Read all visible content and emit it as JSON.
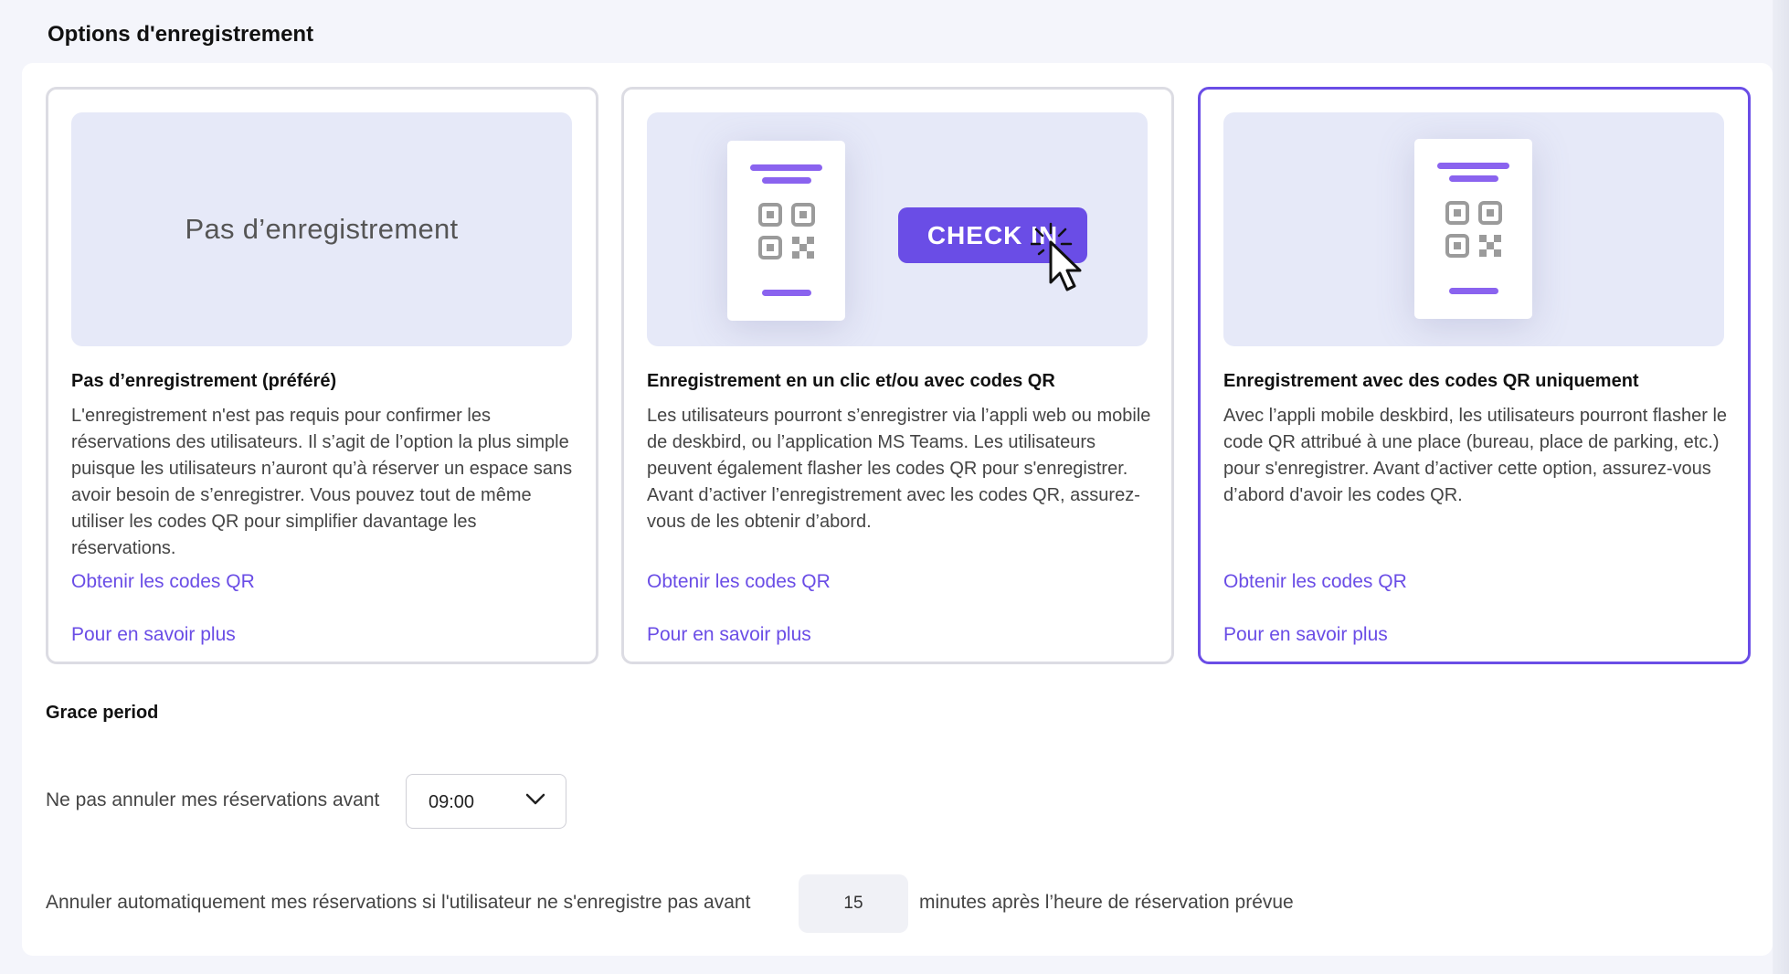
{
  "header": {
    "title": "Options d'enregistrement"
  },
  "cards": [
    {
      "illustration_text": "Pas d’enregistrement",
      "title": "Pas d’enregistrement (préféré)",
      "description": "L'enregistrement n'est pas requis pour confirmer les réservations des utilisateurs. Il s’agit de l’option la plus simple puisque les utilisateurs n’auront qu’à réserver un espace sans avoir besoin de s’enregistrer. Vous pouvez tout de même utiliser les codes QR pour simplifier davantage les réservations.",
      "link_qr": "Obtenir les codes QR",
      "link_more": "Pour en savoir plus",
      "selected": false
    },
    {
      "illustration_button": "CHECK IN",
      "title": "Enregistrement en un clic et/ou avec codes QR",
      "description": "Les utilisateurs pourront s’enregistrer via l’appli web ou mobile de deskbird, ou l’application MS Teams. Les utilisateurs peuvent également flasher les codes QR pour s'enregistrer. Avant d’activer l’enregistrement avec les codes QR, assurez-vous de les obtenir d’abord.",
      "link_qr": "Obtenir les codes QR",
      "link_more": "Pour en savoir plus",
      "selected": false
    },
    {
      "title": "Enregistrement avec des codes QR uniquement",
      "description": "Avec l’appli mobile deskbird, les utilisateurs pourront flasher le code QR attribué à une place (bureau, place de parking, etc.) pour s'enregistrer. Avant d’activer cette option, assurez-vous d’abord d'avoir les codes QR.",
      "link_qr": "Obtenir les codes QR",
      "link_more": "Pour en savoir plus",
      "selected": true
    }
  ],
  "grace": {
    "title": "Grace period",
    "cancel_before_label": "Ne pas annuler mes réservations avant",
    "time_value": "09:00",
    "auto_cancel_label": "Annuler automatiquement mes réservations si l'utilisateur ne s'enregistre pas avant",
    "minutes_value": "15",
    "minutes_suffix": "minutes après l’heure de réservation prévue"
  },
  "colors": {
    "accent": "#6a4de6",
    "illustration_bg": "#e6e9f8",
    "qr_bar": "#8a63ef"
  },
  "icons": [
    "qr-code-icon",
    "cursor-click-icon",
    "chevron-down-icon"
  ]
}
